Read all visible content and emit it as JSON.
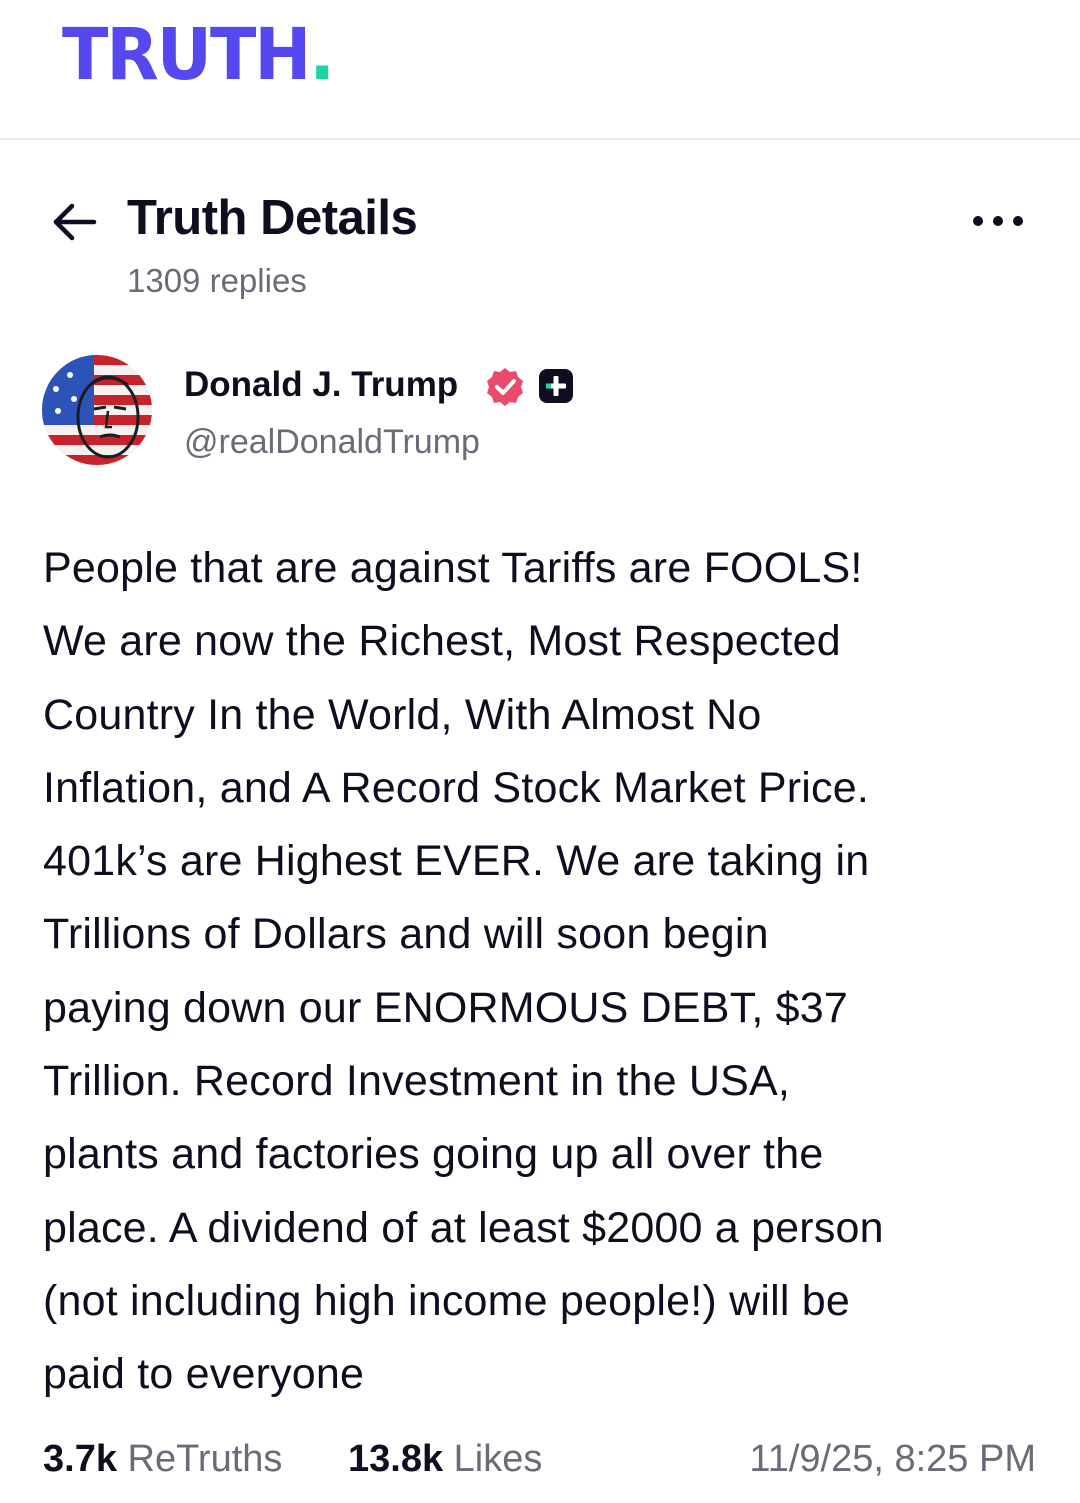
{
  "app": {
    "logo_text": "TRUTH",
    "logo_dot": ".",
    "brand_color": "#5448ee",
    "accent_color": "#1ed3a4"
  },
  "header": {
    "back_icon": "arrow-left-icon",
    "title": "Truth Details",
    "replies": "1309 replies",
    "more_icon": "ellipsis-icon"
  },
  "author": {
    "name": "Donald J. Trump",
    "handle": "@realDonaldTrump",
    "verified_icon": "verified-badge-icon",
    "verified_color": "#ea4b6d",
    "plus_icon": "plus-badge-icon"
  },
  "post": {
    "lines": [
      "People that are against Tariffs are FOOLS!",
      "We are now the Richest, Most Respected",
      "Country In the World, With Almost No",
      "Inflation, and A Record Stock Market Price.",
      "401k’s are Highest EVER. We are taking in",
      "Trillions of Dollars and will soon begin",
      "paying down our ENORMOUS DEBT, $37",
      "Trillion. Record Investment in the USA,",
      "plants and factories going up all over the",
      "place. A dividend of at least $2000 a person",
      "(not including high income people!) will be",
      "paid to everyone"
    ]
  },
  "stats": {
    "retruths_count": "3.7k",
    "retruths_label": "ReTruths",
    "likes_count": "13.8k",
    "likes_label": "Likes",
    "timestamp": "11/9/25, 8:25 PM"
  }
}
